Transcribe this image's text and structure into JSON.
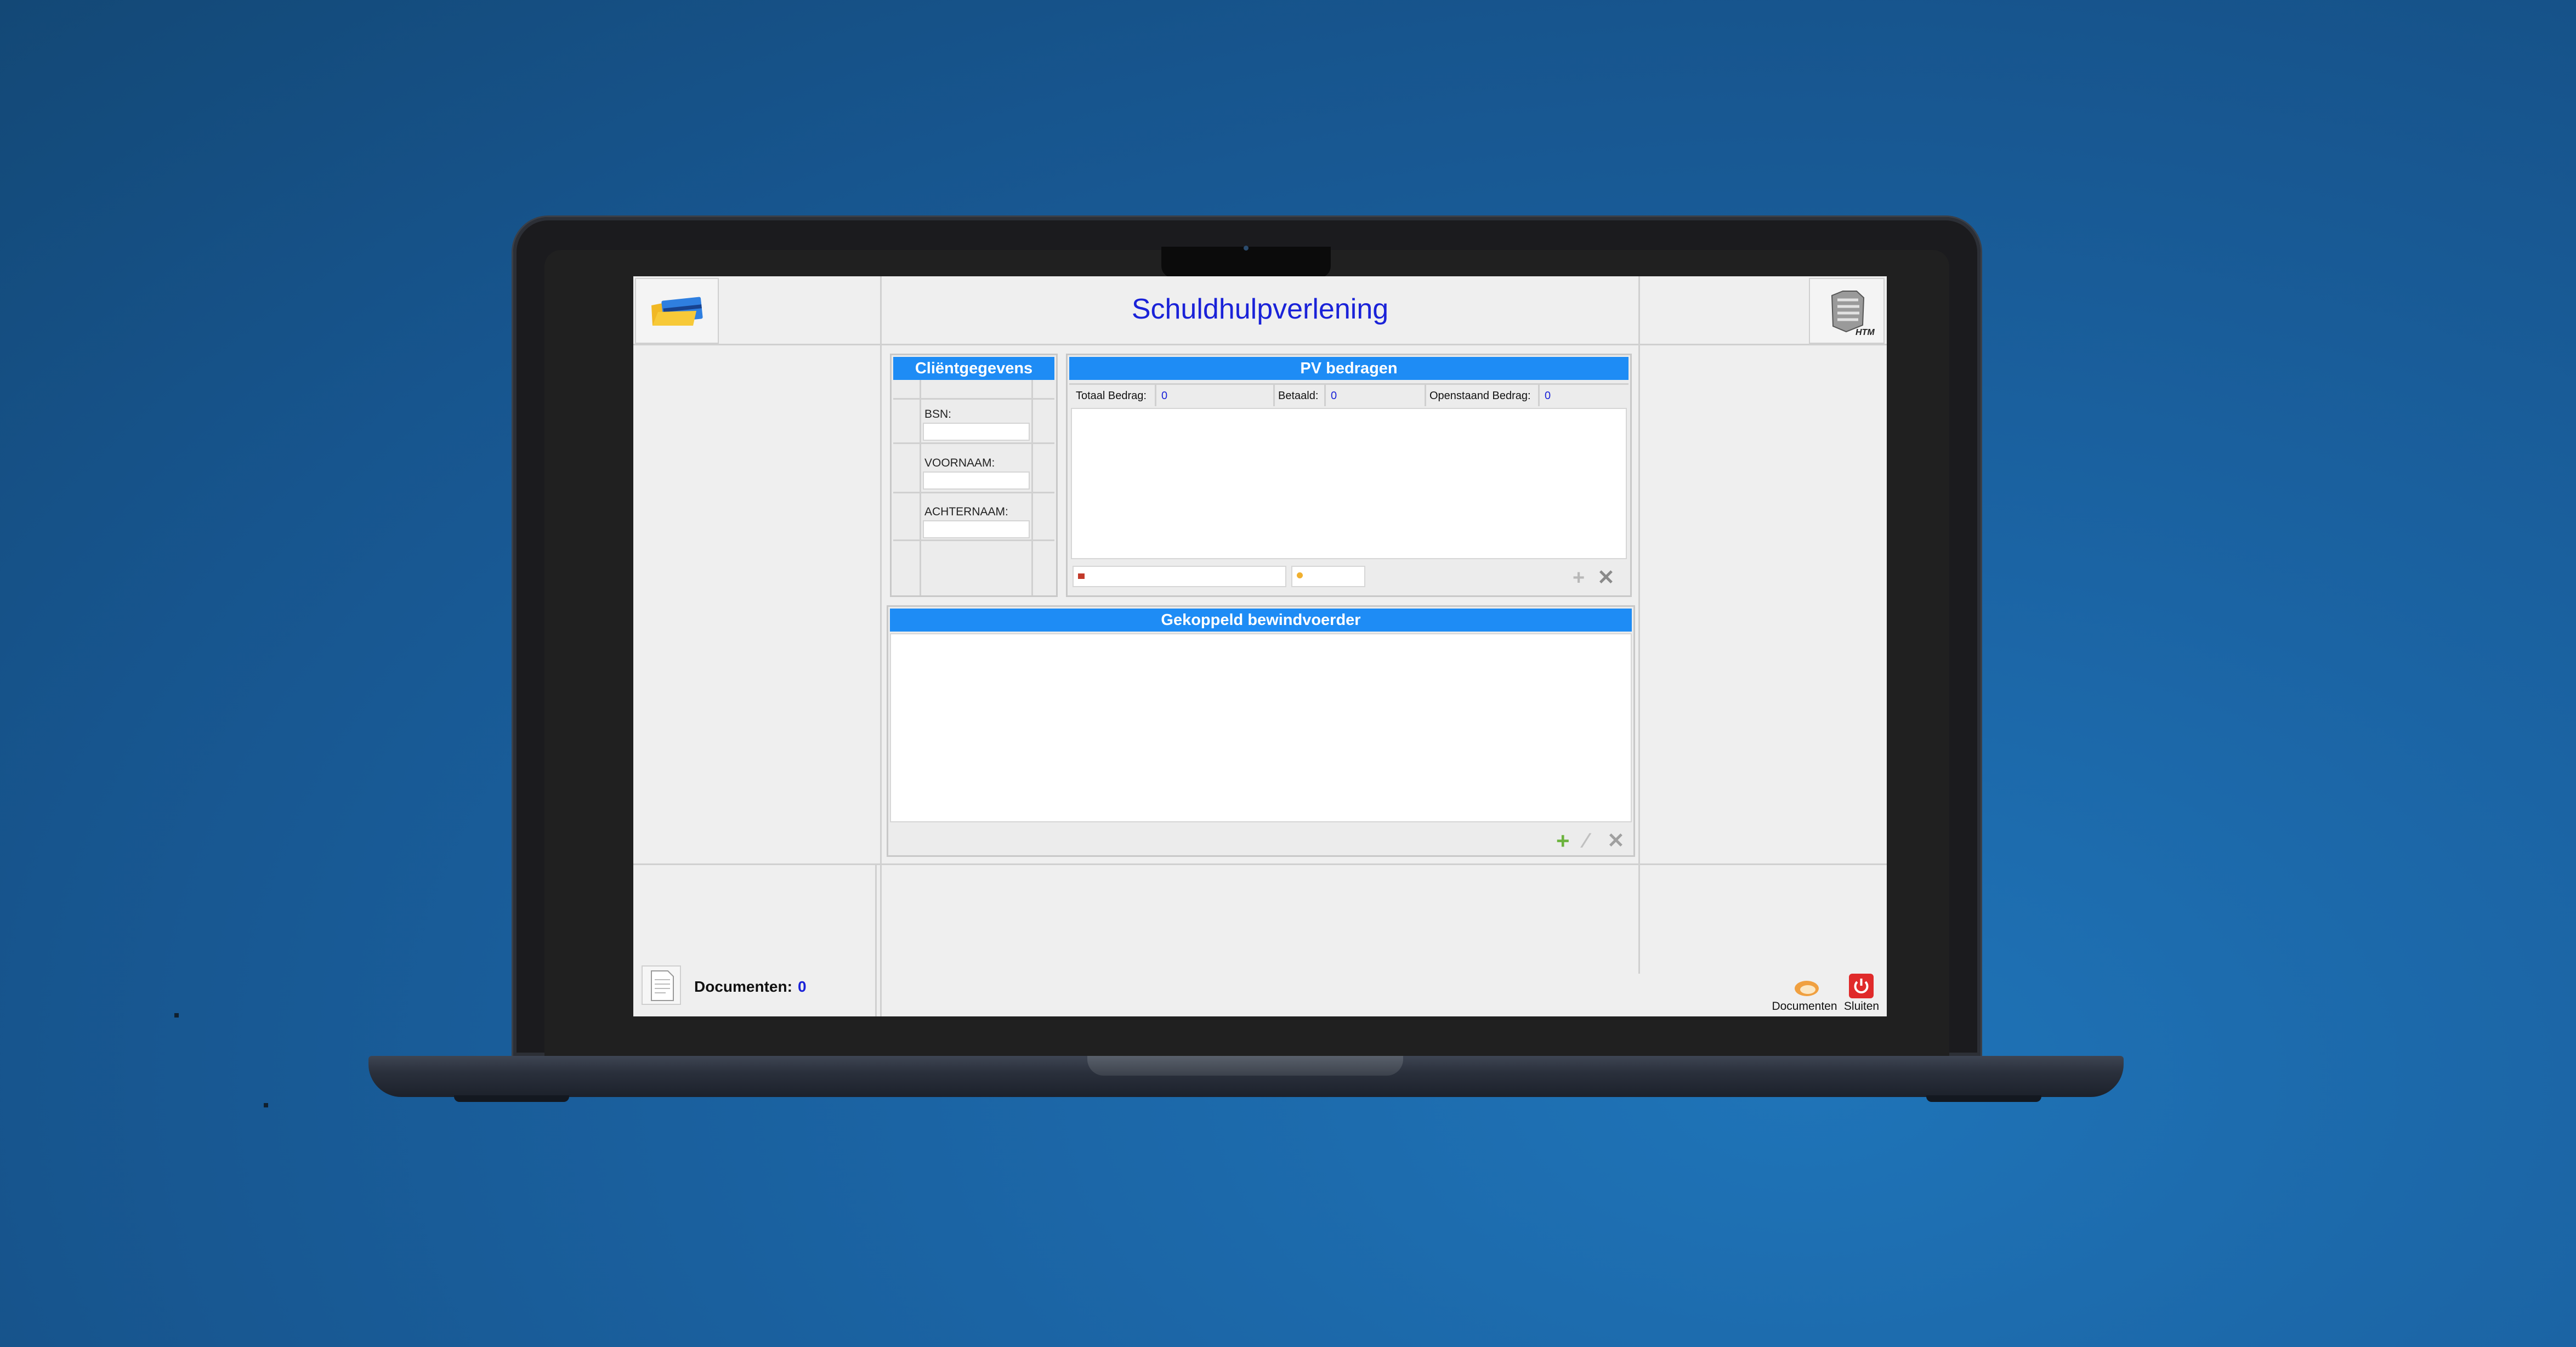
{
  "app": {
    "title": "Schuldhulpverlening",
    "app_icon": "folder-card-icon",
    "org_icon": "htm-logo-icon",
    "org_text": "HTM"
  },
  "client_panel": {
    "header": "Cliëntgegevens",
    "fields": [
      {
        "label": "BSN:",
        "value": ""
      },
      {
        "label": "VOORNAAM:",
        "value": ""
      },
      {
        "label": "ACHTERNAAM:",
        "value": ""
      }
    ]
  },
  "pv_panel": {
    "header": "PV bedragen",
    "totals": [
      {
        "label": "Totaal Bedrag:",
        "value": "0"
      },
      {
        "label": "Betaald:",
        "value": "0"
      },
      {
        "label": "Openstaand Bedrag:",
        "value": "0"
      }
    ]
  },
  "bewindvoerder_panel": {
    "header": "Gekoppeld bewindvoerder"
  },
  "footer": {
    "documents_label": "Documenten:",
    "documents_count": "0",
    "documents_button_label": "Documenten",
    "close_button_label": "Sluiten"
  },
  "colors": {
    "accent_blue": "#1e8cf5",
    "title_blue": "#1a22d8",
    "add_green": "#6cb33e",
    "close_red": "#e02a2a"
  }
}
